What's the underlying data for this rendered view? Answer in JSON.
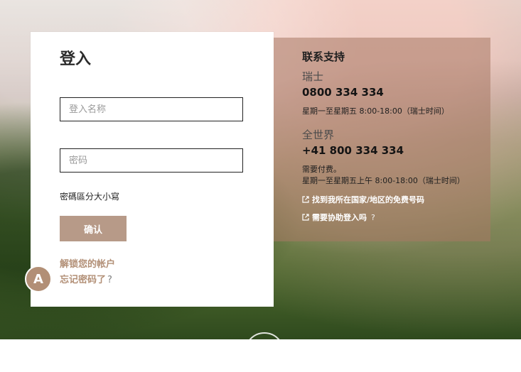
{
  "login": {
    "title": "登入",
    "username_placeholder": "登入名称",
    "password_placeholder": "密码",
    "case_note": "密碼區分大小寫",
    "confirm_label": "确认",
    "unlock_label": "解锁您的帐户",
    "forgot_label": "忘记密码了",
    "forgot_qmark": "?"
  },
  "avatar": {
    "letter": "A"
  },
  "support": {
    "title": "联系支持",
    "switzerland": {
      "label": "瑞士",
      "phone": "0800 334 334",
      "hours": "星期一至星期五 8:00-18:00（瑞士时间）"
    },
    "worldwide": {
      "label": "全世界",
      "phone": "+41 800 334 334",
      "fee_note": "需要付费。",
      "hours": "星期一至星期五上午 8:00-18:00（瑞士时间）"
    },
    "links": [
      {
        "label": "找到我所在国家/地区的免费号码",
        "icon": "external-link-icon"
      },
      {
        "label": "需要协助登入吗",
        "qmark": "?",
        "icon": "external-link-icon"
      }
    ]
  },
  "colors": {
    "accent": "#b79a88",
    "link": "#b28f76",
    "support_panel": "#a77864"
  }
}
